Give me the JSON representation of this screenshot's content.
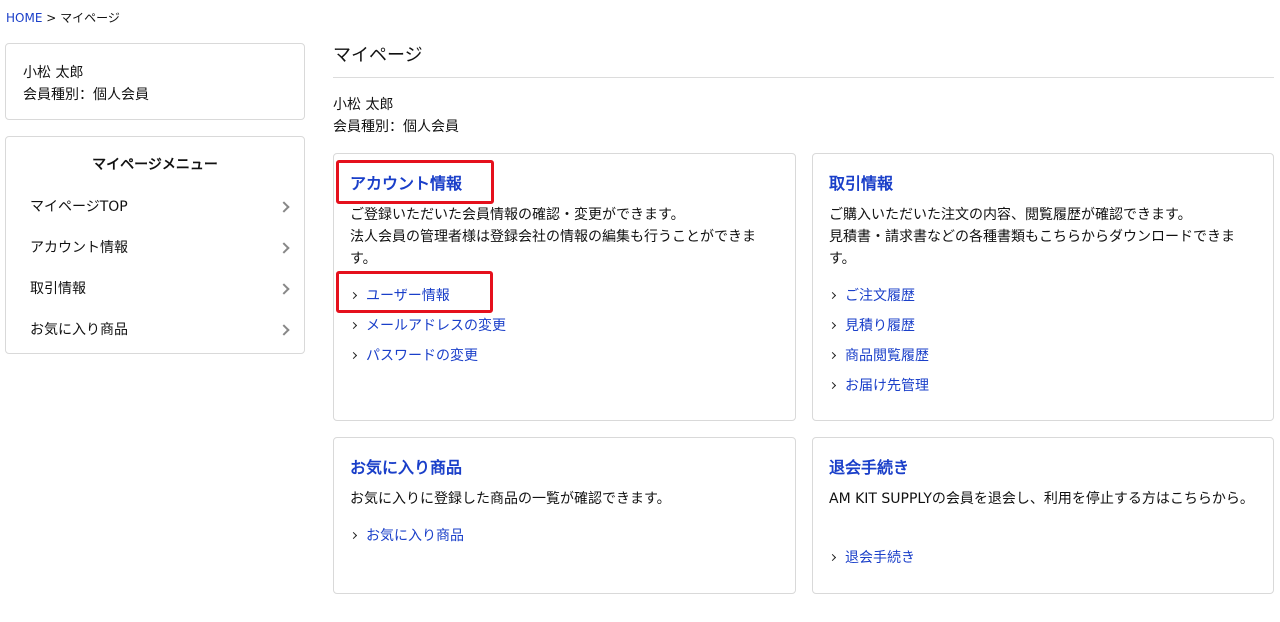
{
  "breadcrumb": {
    "home": "HOME",
    "separator": " > ",
    "current": "マイページ"
  },
  "sidebar": {
    "user_name": "小松 太郎",
    "member_type": "会員種別：個人会員",
    "menu_title": "マイページメニュー",
    "items": [
      {
        "label": "マイページTOP"
      },
      {
        "label": "アカウント情報"
      },
      {
        "label": "取引情報"
      },
      {
        "label": "お気に入り商品"
      }
    ]
  },
  "main": {
    "title": "マイページ",
    "user_name": "小松 太郎",
    "member_type": "会員種別：個人会員"
  },
  "cards": {
    "account": {
      "title": "アカウント情報",
      "desc": "ご登録いただいた会員情報の確認・変更ができます。\n法人会員の管理者様は登録会社の情報の編集も行うことができます。",
      "links": [
        "ユーザー情報",
        "メールアドレスの変更",
        "パスワードの変更"
      ]
    },
    "trade": {
      "title": "取引情報",
      "desc": "ご購入いただいた注文の内容、閲覧履歴が確認できます。\n見積書・請求書などの各種書類もこちらからダウンロードできます。",
      "links": [
        "ご注文履歴",
        "見積り履歴",
        "商品閲覧履歴",
        "お届け先管理"
      ]
    },
    "favorites": {
      "title": "お気に入り商品",
      "desc": "お気に入りに登録した商品の一覧が確認できます。",
      "links": [
        "お気に入り商品"
      ]
    },
    "withdraw": {
      "title": "退会手続き",
      "desc": "AM KIT SUPPLYの会員を退会し、利用を停止する方はこちらから。",
      "links": [
        "退会手続き"
      ]
    }
  },
  "colors": {
    "link": "#1a3fc9",
    "highlight": "#e5101c",
    "border": "#d9d9d9"
  }
}
